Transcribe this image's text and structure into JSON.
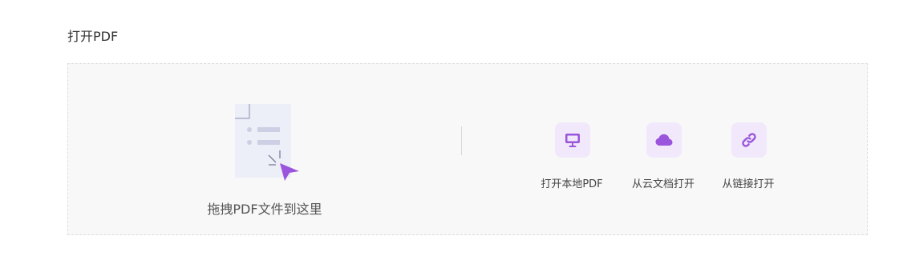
{
  "section": {
    "title": "打开PDF"
  },
  "drop_zone": {
    "label": "拖拽PDF文件到这里",
    "illustration_icon": "document-drop-icon"
  },
  "options": [
    {
      "label": "打开本地PDF",
      "icon": "monitor-icon"
    },
    {
      "label": "从云文档打开",
      "icon": "cloud-icon"
    },
    {
      "label": "从链接打开",
      "icon": "link-icon"
    }
  ],
  "colors": {
    "accent": "#9a55dc",
    "icon_tile_bg": "#f1e9fb",
    "panel_bg": "#f8f8f8",
    "panel_border": "#dcdcdc",
    "illustration_bg": "#eceef8"
  }
}
